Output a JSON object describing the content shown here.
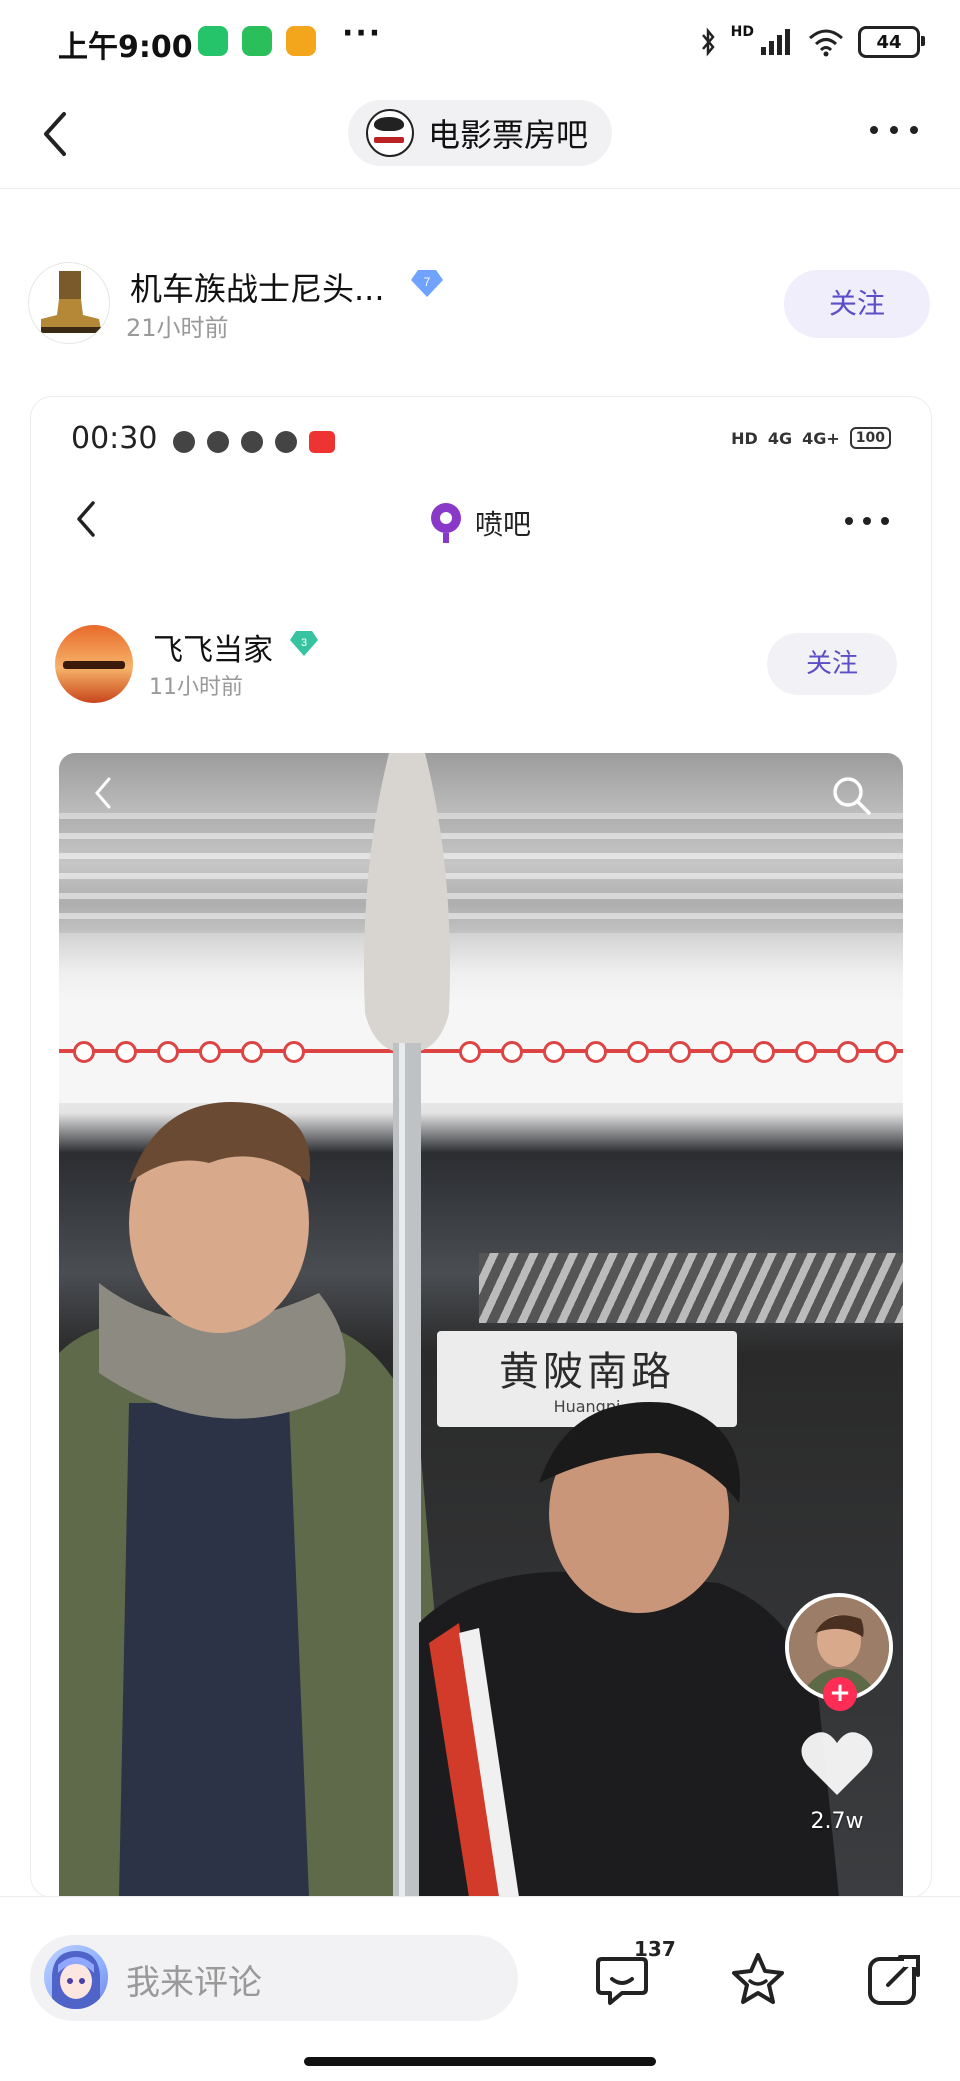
{
  "status_bar": {
    "time": "上午9:00",
    "more": "···",
    "battery": "44",
    "network": "HD"
  },
  "nav": {
    "forum_name": "电影票房吧"
  },
  "post": {
    "author_name": "机车族战士尼头...",
    "level": "7",
    "time_ago": "21小时前",
    "follow_label": "关注"
  },
  "embedded": {
    "status_time": "00:30",
    "status_right": [
      "HD",
      "4G",
      "4G+"
    ],
    "battery": "100",
    "forum_name": "喷吧",
    "author_name": "飞飞当家",
    "level": "3",
    "time_ago": "11小时前",
    "follow_label": "关注",
    "station_name_zh": "黄陂南路",
    "station_name_en": "Huangpi",
    "like_count": "2.7w"
  },
  "bottom_bar": {
    "comment_placeholder": "我来评论",
    "reply_count": "137"
  },
  "colors": {
    "accent": "#5b4ec7",
    "follow_bg": "#f0eefb",
    "like_plus": "#ff2c55"
  },
  "icons": [
    "back-icon",
    "more-icon",
    "verified-badge-icon",
    "search-icon",
    "heart-icon",
    "comment-icon",
    "star-icon",
    "share-icon"
  ]
}
